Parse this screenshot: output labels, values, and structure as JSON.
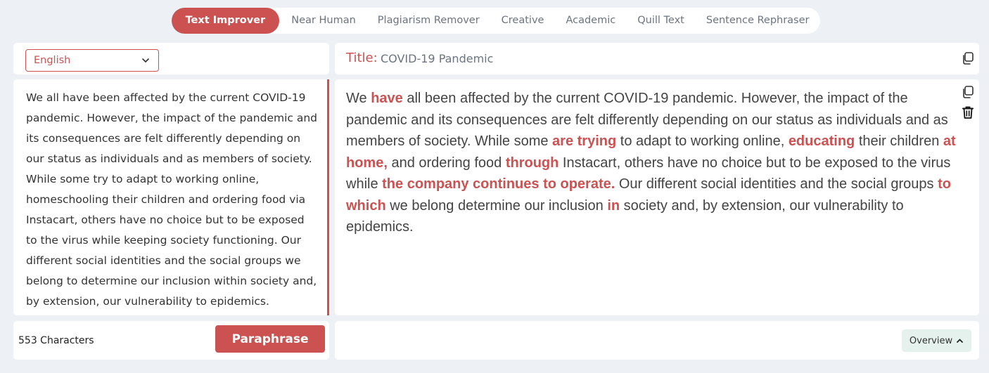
{
  "tabs": [
    {
      "label": "Text Improver",
      "active": true
    },
    {
      "label": "Near Human"
    },
    {
      "label": "Plagiarism Remover"
    },
    {
      "label": "Creative"
    },
    {
      "label": "Academic"
    },
    {
      "label": "Quill Text"
    },
    {
      "label": "Sentence Rephraser"
    }
  ],
  "language": {
    "selected": "English"
  },
  "title": {
    "label": "Title:",
    "value": "COVID-19 Pandemic"
  },
  "input": {
    "text": "We all have been affected by the current COVID-19 pandemic. However, the impact of the pandemic and its consequences are felt differently depending on our status as individuals and as members of society. While some try to adapt to working online, homeschooling their children and ordering food via Instacart, others have no choice but to be exposed to the virus while keeping society functioning. Our different social identities and the social groups we belong to determine our inclusion within society and, by extension, our vulnerability to epidemics."
  },
  "output": {
    "segments": [
      {
        "t": "We ",
        "h": false
      },
      {
        "t": "have",
        "h": true
      },
      {
        "t": " all been affected by the current COVID-19 pandemic. However, the impact of the pandemic and its consequences are felt differently depending on our status as individuals and as members of society. While some ",
        "h": false
      },
      {
        "t": "are trying",
        "h": true
      },
      {
        "t": " to adapt to working online, ",
        "h": false
      },
      {
        "t": "educating",
        "h": true
      },
      {
        "t": " their children ",
        "h": false
      },
      {
        "t": "at home,",
        "h": true
      },
      {
        "t": " and ordering food ",
        "h": false
      },
      {
        "t": "through",
        "h": true
      },
      {
        "t": " Instacart, others have no choice but to be exposed to the virus while ",
        "h": false
      },
      {
        "t": "the company continues to operate.",
        "h": true
      },
      {
        "t": " Our different social identities and the social groups ",
        "h": false
      },
      {
        "t": "to which",
        "h": true
      },
      {
        "t": " we belong determine our inclusion ",
        "h": false
      },
      {
        "t": "in",
        "h": true
      },
      {
        "t": " society and, by extension, our vulnerability to epidemics.",
        "h": false
      }
    ]
  },
  "footer": {
    "char_count": "553 Characters",
    "paraphrase_label": "Paraphrase",
    "overview_label": "Overview"
  },
  "icons": {
    "copy_title": "copy-icon",
    "copy_output": "copy-icon",
    "delete_output": "trash-icon",
    "language_chevron": "chevron-down-icon",
    "overview_chevron": "chevron-up-icon"
  },
  "colors": {
    "accent": "#cc5252",
    "background": "#edf1f5",
    "overview_bg": "#e4f1ec",
    "tab_text": "#6b7480"
  }
}
